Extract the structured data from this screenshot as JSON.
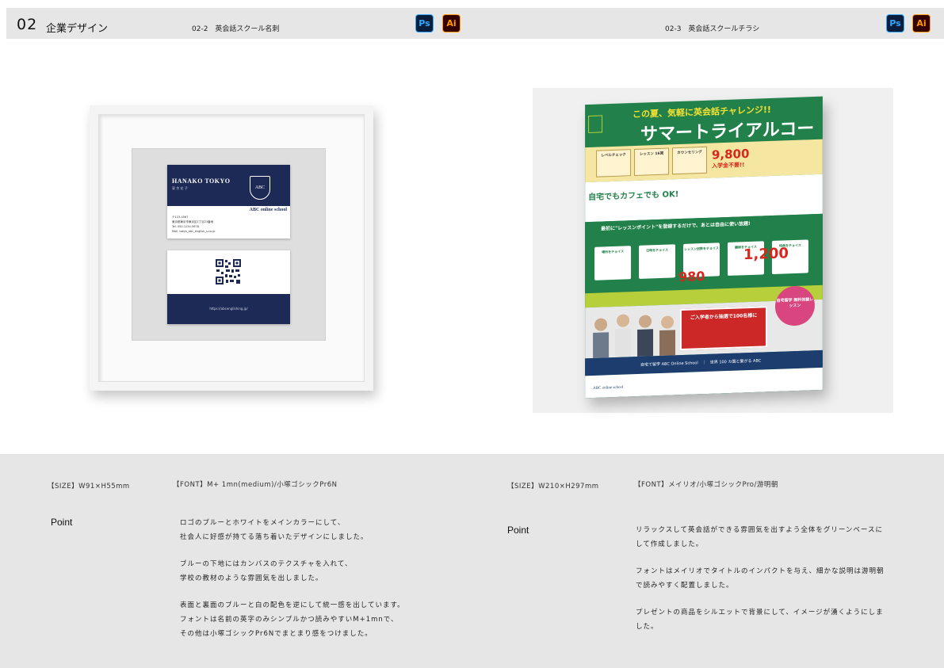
{
  "header": {
    "section_number": "02",
    "section_title": "企業デザイン",
    "left_subtitle": "02-2　英会話スクール名刺",
    "right_subtitle": "02-3　英会話スクールチラシ",
    "tool_badges": {
      "ps": "Ps",
      "ai": "Ai"
    }
  },
  "business_card": {
    "name": "HANAKO TOKYO",
    "name_kana": "東 京 花 子",
    "crest_text": "ABC",
    "school": "ABC online school",
    "lines": [
      "〒123-4567",
      "東京都東京市東京区1丁目23番地",
      "Tel. 000-1234-5678",
      "Mail. tokyo_abc_english_s.co.jp"
    ],
    "back_url": "https://abcenglishing.jp/"
  },
  "flyer": {
    "headline": "この夏、気軽に英会話チャレンジ!!",
    "title": "サマートライアルコース",
    "boxes": [
      "レベルチェック",
      "レッスン 16回",
      "カウンセリング"
    ],
    "price": "9,800",
    "price_note": "入学金不要!!",
    "white_title": "自宅でもカフェでも OK!",
    "mid_title": "最初に\"レッスンポイント\"を登録するだけで、あとは自由に使い放題!",
    "mini_titles": [
      "場所をチョイス",
      "日時をチョイス",
      "レッスン回数をチョイス",
      "講師をチョイス",
      "特典をチョイス"
    ],
    "price_980": "980",
    "price_1200": "1,200",
    "campaign": "ご入学者から抽選で100名様に",
    "pink": "自宅留学 無料体験レッスン",
    "navy_text": "自宅で留学 ABC Online School　｜　世界 100 カ国と繋がる ABC",
    "footer": "ABC online school"
  },
  "specs": {
    "left_size": "【SIZE】W91×H55mm",
    "left_font": "【FONT】M+ 1mn(medium)/小塚ゴシックPr6N",
    "right_size": "【SIZE】W210×H297mm",
    "right_font": "【FONT】メイリオ/小塚ゴシックPro/游明朝"
  },
  "points": {
    "label": "Point",
    "left": [
      "ロゴのブルーとホワイトをメインカラーにして、",
      "社会人に好感が持てる落ち着いたデザインにしました。",
      "ブルーの下地にはカンバスのテクスチャを入れて、",
      "学校の教材のような雰囲気を出しました。",
      "表面と裏面のブルーと白の配色を逆にして統一感を出しています。",
      "フォントは名前の英字のみシンプルかつ読みやすいM+1mnで、",
      "その他は小塚ゴシックPr6Nでまとまり感をつけました。"
    ],
    "right": [
      "リラックスして英会話ができる雰囲気を出すよう全体をグリーンベースに",
      "して作成しました。",
      "フォントはメイリオでタイトルのインパクトを与え、細かな説明は游明朝",
      "で読みやすく配置しました。",
      "プレゼントの商品をシルエットで背景にして、イメージが湧くようにしま",
      "した。"
    ]
  },
  "colors": {
    "navy": "#1d2a56",
    "green": "#22804a",
    "band": "#e6e6e6"
  }
}
